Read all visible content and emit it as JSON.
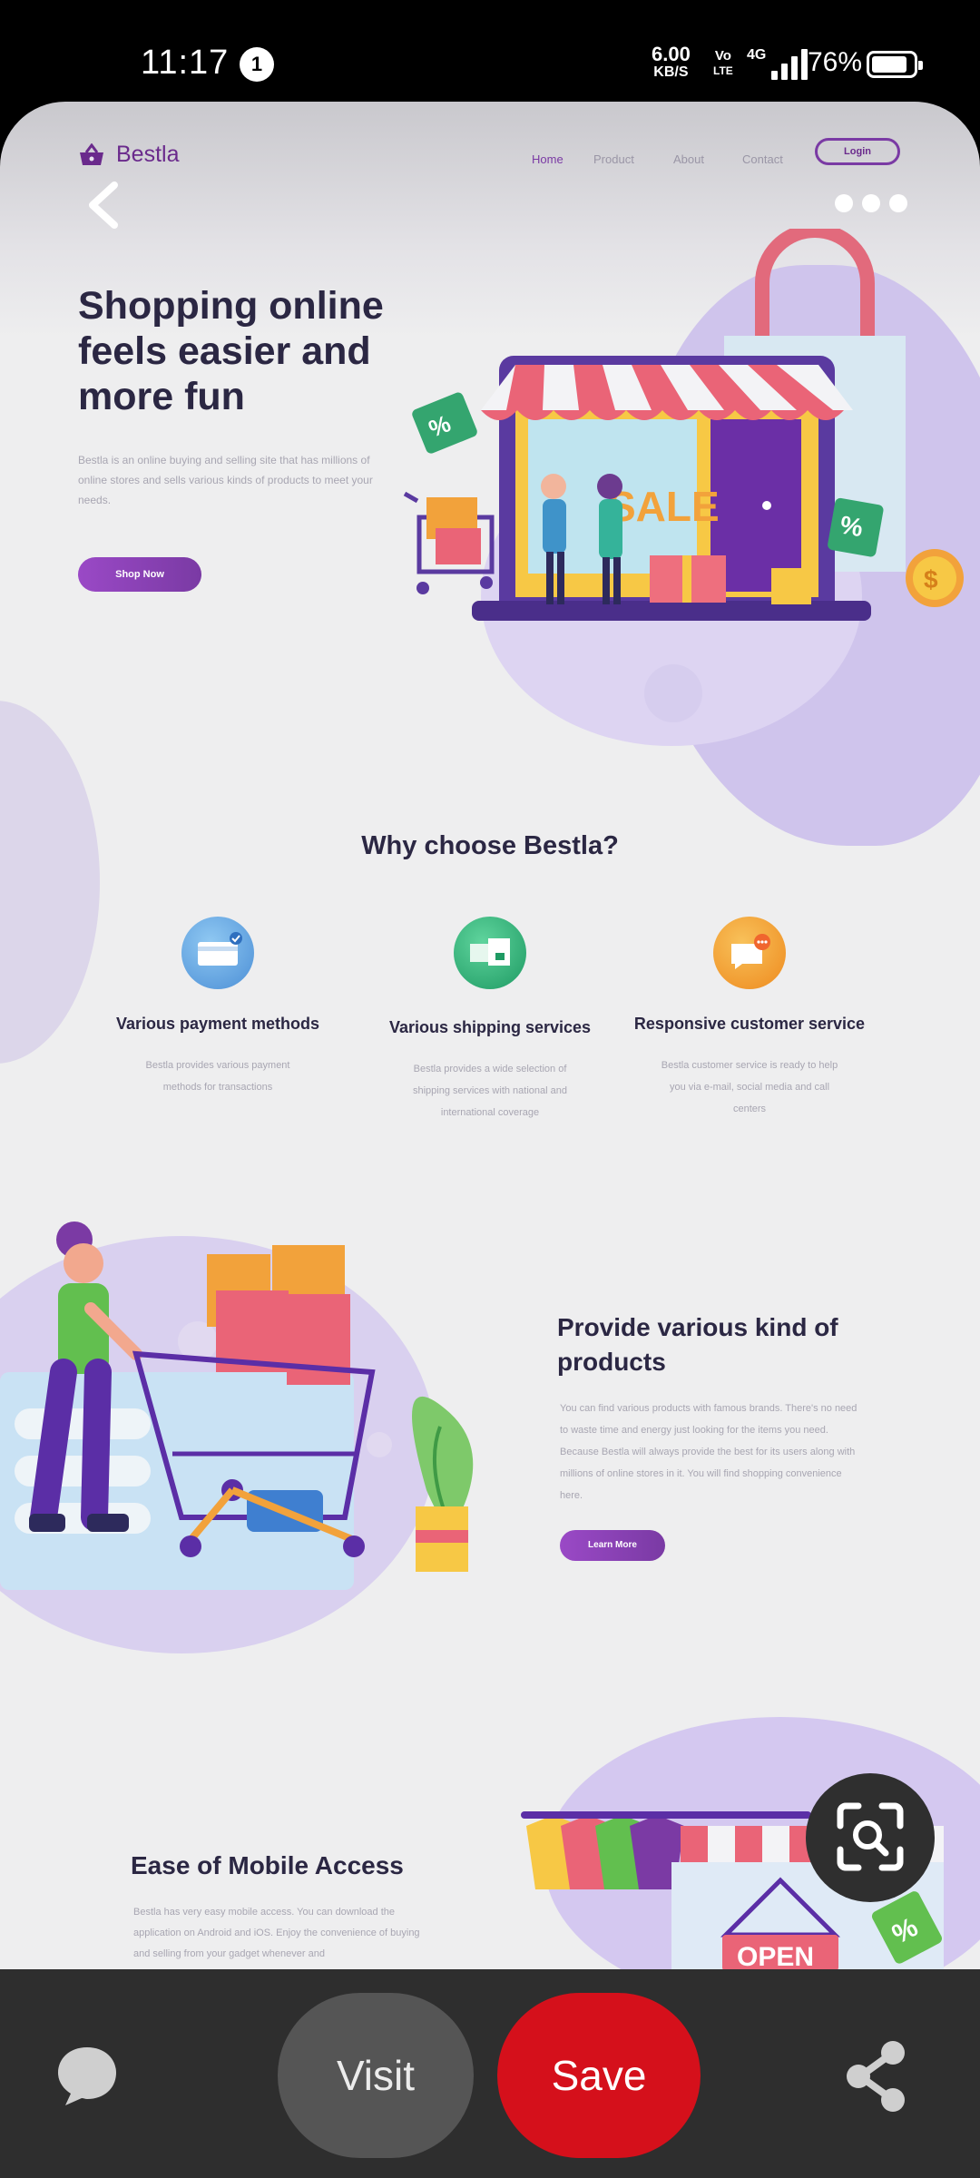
{
  "status_bar": {
    "time": "11:17",
    "notification_count": "1",
    "net_speed": "6.00",
    "net_speed_unit": "KB/S",
    "volte_top": "Vo",
    "volte_bottom": "LTE",
    "network": "4G",
    "battery": "76%"
  },
  "pin": {
    "nav": {
      "brand": "Bestla",
      "links": [
        "Home",
        "Product",
        "About",
        "Contact"
      ],
      "login": "Login"
    },
    "hero": {
      "title": "Shopping online feels easier and more fun",
      "description": "Bestla is an online buying and selling site that has millions of online stores and sells various kinds of products to meet your needs.",
      "cta": "Shop Now",
      "sign_text": "SALE"
    },
    "why": {
      "title": "Why choose Bestla?",
      "features": [
        {
          "title": "Various payment methods",
          "description": "Bestla provides various payment methods for transactions"
        },
        {
          "title": "Various shipping services",
          "description": "Bestla provides a wide selection of shipping services with national and international coverage"
        },
        {
          "title": "Responsive customer service",
          "description": "Bestla customer service is ready to help you via e-mail, social media and call centers"
        }
      ]
    },
    "products": {
      "title": "Provide various kind of products",
      "description": "You can find various products with famous brands. There's no need to waste time and energy just looking for the items you need. Because Bestla will always provide the best for its users along with millions of online stores in it. You will find shopping convenience here.",
      "cta": "Learn More"
    },
    "mobile": {
      "title": "Ease of Mobile Access",
      "description": "Bestla has very easy mobile access. You can download the application on Android and iOS. Enjoy the convenience of buying and selling from your gadget whenever and",
      "sign_text": "OPEN"
    }
  },
  "actions": {
    "visit": "Visit",
    "save": "Save"
  },
  "icons": [
    "back-icon",
    "more-icon",
    "lens-search-icon",
    "comment-icon",
    "share-icon",
    "basket-icon"
  ],
  "colors": {
    "brand_purple": "#7a3aa4",
    "save_red": "#d5101b",
    "heading": "#2b2743"
  }
}
